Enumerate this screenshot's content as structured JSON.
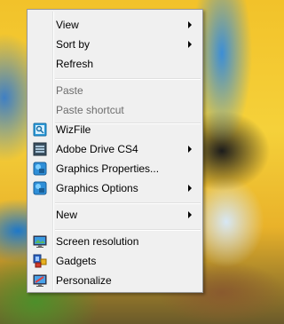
{
  "context_menu": {
    "items": [
      {
        "label": "View"
      },
      {
        "label": "Sort by"
      },
      {
        "label": "Refresh"
      },
      {
        "label": "Paste"
      },
      {
        "label": "Paste shortcut"
      },
      {
        "label": "WizFile",
        "icon": "wizfile-icon"
      },
      {
        "label": "Adobe Drive CS4",
        "icon": "adobe-drive-icon"
      },
      {
        "label": "Graphics Properties...",
        "icon": "intel-graphics-icon"
      },
      {
        "label": "Graphics Options",
        "icon": "intel-graphics-icon"
      },
      {
        "label": "New"
      },
      {
        "label": "Screen resolution",
        "icon": "monitor-icon"
      },
      {
        "label": "Gadgets",
        "icon": "gadgets-icon"
      },
      {
        "label": "Personalize",
        "icon": "personalize-icon"
      }
    ]
  }
}
